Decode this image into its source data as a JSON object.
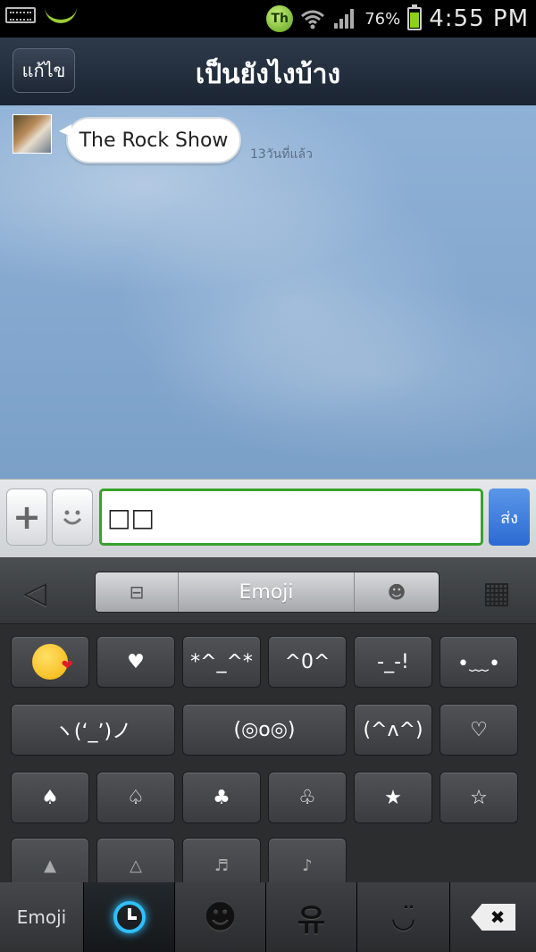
{
  "status_bar": {
    "th_badge": "Th",
    "battery_percent": "76%",
    "battery_level": 0.76,
    "time": "4:55 PM",
    "icons": [
      "keyboard-icon",
      "leaf-icon",
      "th-badge-icon",
      "wifi-icon",
      "signal-icon",
      "battery-icon"
    ]
  },
  "header": {
    "edit_label": "แก้ไข",
    "title": "เป็นยังไงบ้าง"
  },
  "chat": {
    "messages": [
      {
        "text": "The Rock Show",
        "time": "13วันที่แล้ว"
      }
    ]
  },
  "input_bar": {
    "plus": "+",
    "smile": "◡̈",
    "value": "□□",
    "send_label": "ส่ง"
  },
  "keyboard": {
    "back_glyph": "◁",
    "segments": [
      "⊟",
      "Emoji",
      "☻"
    ],
    "grid_glyph": "▦",
    "keys_row1": [
      "😘",
      "♥",
      "*^_^*",
      "^0^",
      "-_-!",
      "•﹏•"
    ],
    "keys_row2": [
      "ヽ(ʻ_ʼ)ノ",
      "(◎o◎)",
      "(^ᴧ^)",
      "♡"
    ],
    "keys_row3": [
      "♠",
      "♤",
      "♣",
      "♧",
      "★",
      "☆"
    ],
    "keys_row4": [
      "▲",
      "△",
      "♬",
      "♪"
    ],
    "tabs": [
      "Emoji",
      "clock-icon",
      "☻",
      "유",
      "◡̈",
      "✖"
    ]
  }
}
